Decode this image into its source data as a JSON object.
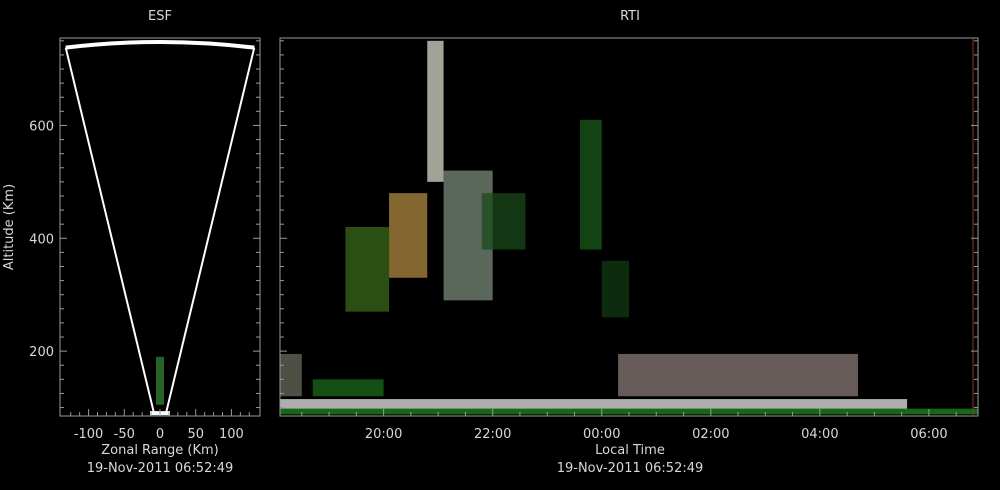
{
  "chart_data": [
    {
      "type": "heatmap",
      "title": "ESF",
      "xlabel": "Zonal Range (Km)",
      "ylabel": "Altitude (Km)",
      "xlim": [
        -140,
        140
      ],
      "ylim": [
        85,
        755
      ],
      "x_ticks": [
        -100,
        -50,
        0,
        50,
        100
      ],
      "y_ticks": [
        200,
        400,
        600
      ],
      "timestamp": "19-Nov-2011 06:52:49",
      "fan": {
        "apex": [
          0,
          90
        ],
        "left_top": [
          -132,
          738
        ],
        "right_top": [
          132,
          738
        ],
        "arc_top": 748
      },
      "echoes": [
        {
          "x": 0,
          "alt_low": 105,
          "alt_high": 190,
          "color": "#2e7d2e"
        }
      ]
    },
    {
      "type": "heatmap",
      "title": "RTI",
      "xlabel": "Local Time",
      "ylabel": "Altitude (Km)",
      "xlim": [
        18.1,
        30.9
      ],
      "ylim": [
        85,
        755
      ],
      "x_ticks": [
        "20:00",
        "22:00",
        "00:00",
        "02:00",
        "04:00",
        "06:00"
      ],
      "x_tick_hours": [
        20,
        22,
        24,
        26,
        28,
        30
      ],
      "y_ticks": [
        200,
        400,
        600
      ],
      "timestamp": "19-Nov-2011 06:52:49",
      "echoes": [
        {
          "t0": 18.1,
          "t1": 30.9,
          "alt0": 88,
          "alt1": 98,
          "color": "#1f8a1f"
        },
        {
          "t0": 18.1,
          "t1": 29.6,
          "alt0": 98,
          "alt1": 115,
          "color": "#e8e8e8"
        },
        {
          "t0": 24.3,
          "t1": 28.7,
          "alt0": 120,
          "alt1": 195,
          "color": "#8a7a78"
        },
        {
          "t0": 18.1,
          "t1": 18.5,
          "alt0": 120,
          "alt1": 195,
          "color": "#6a6a5a"
        },
        {
          "t0": 18.7,
          "t1": 20.0,
          "alt0": 120,
          "alt1": 150,
          "color": "#1c6a1c"
        },
        {
          "t0": 20.8,
          "t1": 21.1,
          "alt0": 500,
          "alt1": 750,
          "color": "#d8d8c8"
        },
        {
          "t0": 20.1,
          "t1": 20.8,
          "alt0": 330,
          "alt1": 480,
          "color": "#b08a40"
        },
        {
          "t0": 19.3,
          "t1": 20.1,
          "alt0": 270,
          "alt1": 420,
          "color": "#3a6a1a"
        },
        {
          "t0": 21.1,
          "t1": 22.0,
          "alt0": 290,
          "alt1": 520,
          "color": "#7a8a7a"
        },
        {
          "t0": 21.8,
          "t1": 22.6,
          "alt0": 380,
          "alt1": 480,
          "color": "#1a4a1a"
        },
        {
          "t0": 23.6,
          "t1": 24.0,
          "alt0": 380,
          "alt1": 610,
          "color": "#1a5a1a"
        },
        {
          "t0": 24.0,
          "t1": 24.5,
          "alt0": 260,
          "alt1": 360,
          "color": "#123a12"
        }
      ]
    }
  ]
}
